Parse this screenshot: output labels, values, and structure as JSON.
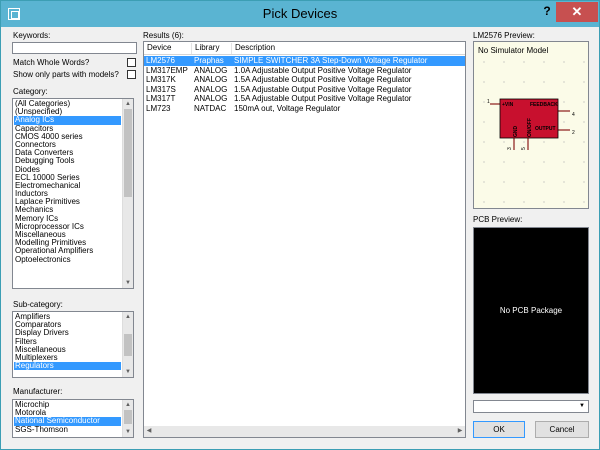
{
  "window": {
    "title": "Pick Devices",
    "help_label": "?",
    "close_label": "✕"
  },
  "left": {
    "keywords_label": "Keywords:",
    "keywords_value": "",
    "match_whole_words": "Match Whole Words?",
    "show_only_models": "Show only parts with models?",
    "category_label": "Category:",
    "categories": [
      "(All Categories)",
      "(Unspecified)",
      "Analog ICs",
      "Capacitors",
      "CMOS 4000 series",
      "Connectors",
      "Data Converters",
      "Debugging Tools",
      "Diodes",
      "ECL 10000 Series",
      "Electromechanical",
      "Inductors",
      "Laplace Primitives",
      "Mechanics",
      "Memory ICs",
      "Microprocessor ICs",
      "Miscellaneous",
      "Modelling Primitives",
      "Operational Amplifiers",
      "Optoelectronics"
    ],
    "category_selected": 2,
    "subcategory_label": "Sub-category:",
    "subcategories": [
      "Amplifiers",
      "Comparators",
      "Display Drivers",
      "Filters",
      "Miscellaneous",
      "Multiplexers",
      "Regulators"
    ],
    "subcategory_selected": 6,
    "manufacturer_label": "Manufacturer:",
    "manufacturers": [
      "Microchip",
      "Motorola",
      "National Semiconductor",
      "SGS-Thomson"
    ],
    "manufacturer_selected": 2
  },
  "results": {
    "label": "Results (6):",
    "columns": [
      "Device",
      "Library",
      "Description"
    ],
    "rows": [
      [
        "LM2576",
        "Praphas",
        "SIMPLE SWITCHER 3A Step-Down Voltage Regulator"
      ],
      [
        "LM317EMP",
        "ANALOG",
        "1.0A Adjustable Output Positive Voltage Regulator"
      ],
      [
        "LM317K",
        "ANALOG",
        "1.5A Adjustable Output Positive Voltage Regulator"
      ],
      [
        "LM317S",
        "ANALOG",
        "1.5A Adjustable Output Positive Voltage Regulator"
      ],
      [
        "LM317T",
        "ANALOG",
        "1.5A Adjustable Output Positive Voltage Regulator"
      ],
      [
        "LM723",
        "NATDAC",
        "150mA out, Voltage Regulator"
      ]
    ],
    "selected_row": 0
  },
  "preview": {
    "sim_title": "LM2576 Preview:",
    "sim_text": "No Simulator Model",
    "schematic": {
      "pin_vin": "+VIN",
      "pin_feedback": "FEEDBACK",
      "pin_output": "OUTPUT",
      "pin_gnd": "GND",
      "pin_onoff": "ON/OFF",
      "num1": "1",
      "num2": "2",
      "num3": "3",
      "num4": "4",
      "num5": "5"
    },
    "pcb_title": "PCB Preview:",
    "pcb_text": "No PCB Package",
    "package_value": ""
  },
  "buttons": {
    "ok": "OK",
    "cancel": "Cancel"
  },
  "colors": {
    "titlebar": "#5ab4d2",
    "selection": "#3399ff",
    "close": "#c75050",
    "chip_body": "#c8102e"
  }
}
